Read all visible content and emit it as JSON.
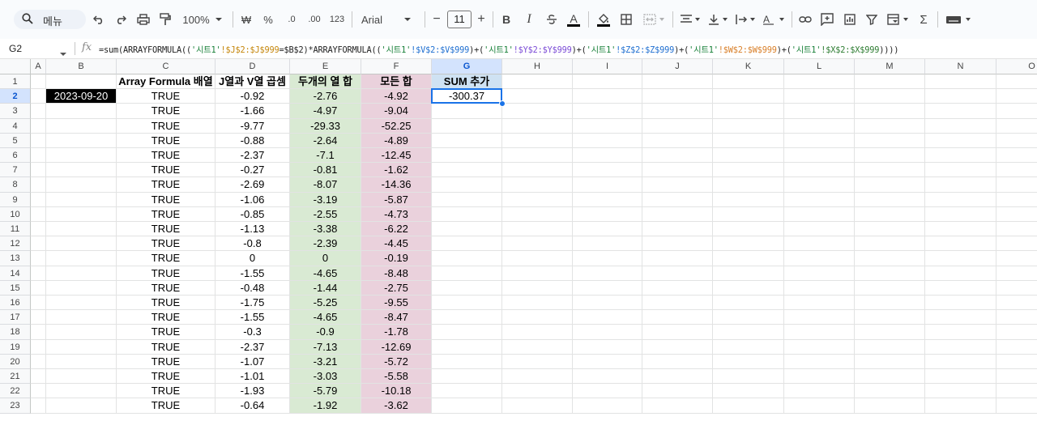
{
  "toolbar": {
    "menu_label": "메뉴",
    "zoom": "100%",
    "currency": "₩",
    "percent": "%",
    "dec_decrease": ".0",
    "dec_increase": ".00",
    "number_format": "123",
    "font_name": "Arial",
    "font_size": "11",
    "minus": "−",
    "plus": "+",
    "bold": "B",
    "italic": "I",
    "text_color_letter": "A",
    "sigma": "Σ"
  },
  "formula_bar": {
    "cell_ref": "G2",
    "fx": "fx",
    "formula_parts": {
      "p1": "=sum(ARRAYFORMULA((",
      "s1": "'시트1'",
      "r1": "!$J$2:$J$999",
      "p2": "=$B$2)*ARRAYFORMULA((",
      "s2": "'시트1'",
      "r2": "!$V$2:$V$999",
      "p3": ")+(",
      "s3": "'시트1'",
      "r3": "!$Y$2:$Y$999",
      "p4": ")+(",
      "s4": "'시트1'",
      "r4": "!$Z$2:$Z$999",
      "p5": ")+(",
      "s5": "'시트1'",
      "r5": "!$W$2:$W$999",
      "p6": ")+(",
      "s6": "'시트1'",
      "r6": "!$X$2:$X$999",
      "p7": "))))"
    }
  },
  "columns": [
    "A",
    "B",
    "C",
    "D",
    "E",
    "F",
    "G",
    "H",
    "I",
    "J",
    "K",
    "L",
    "M",
    "N",
    "O"
  ],
  "headers": {
    "C": "Array Formula 배열",
    "D": "J열과 V열 곱셈",
    "E": "두개의 열 합",
    "F": "모든 합",
    "G": "SUM 추가"
  },
  "date_cell": "2023-09-20",
  "sum_value": "-300.37",
  "rows": [
    {
      "n": "2",
      "c": "TRUE",
      "d": "-0.92",
      "e": "-2.76",
      "f": "-4.92"
    },
    {
      "n": "3",
      "c": "TRUE",
      "d": "-1.66",
      "e": "-4.97",
      "f": "-9.04"
    },
    {
      "n": "4",
      "c": "TRUE",
      "d": "-9.77",
      "e": "-29.33",
      "f": "-52.25"
    },
    {
      "n": "5",
      "c": "TRUE",
      "d": "-0.88",
      "e": "-2.64",
      "f": "-4.89"
    },
    {
      "n": "6",
      "c": "TRUE",
      "d": "-2.37",
      "e": "-7.1",
      "f": "-12.45"
    },
    {
      "n": "7",
      "c": "TRUE",
      "d": "-0.27",
      "e": "-0.81",
      "f": "-1.62"
    },
    {
      "n": "8",
      "c": "TRUE",
      "d": "-2.69",
      "e": "-8.07",
      "f": "-14.36"
    },
    {
      "n": "9",
      "c": "TRUE",
      "d": "-1.06",
      "e": "-3.19",
      "f": "-5.87"
    },
    {
      "n": "10",
      "c": "TRUE",
      "d": "-0.85",
      "e": "-2.55",
      "f": "-4.73"
    },
    {
      "n": "11",
      "c": "TRUE",
      "d": "-1.13",
      "e": "-3.38",
      "f": "-6.22"
    },
    {
      "n": "12",
      "c": "TRUE",
      "d": "-0.8",
      "e": "-2.39",
      "f": "-4.45"
    },
    {
      "n": "13",
      "c": "TRUE",
      "d": "0",
      "e": "0",
      "f": "-0.19"
    },
    {
      "n": "14",
      "c": "TRUE",
      "d": "-1.55",
      "e": "-4.65",
      "f": "-8.48"
    },
    {
      "n": "15",
      "c": "TRUE",
      "d": "-0.48",
      "e": "-1.44",
      "f": "-2.75"
    },
    {
      "n": "16",
      "c": "TRUE",
      "d": "-1.75",
      "e": "-5.25",
      "f": "-9.55"
    },
    {
      "n": "17",
      "c": "TRUE",
      "d": "-1.55",
      "e": "-4.65",
      "f": "-8.47"
    },
    {
      "n": "18",
      "c": "TRUE",
      "d": "-0.3",
      "e": "-0.9",
      "f": "-1.78"
    },
    {
      "n": "19",
      "c": "TRUE",
      "d": "-2.37",
      "e": "-7.13",
      "f": "-12.69"
    },
    {
      "n": "20",
      "c": "TRUE",
      "d": "-1.07",
      "e": "-3.21",
      "f": "-5.72"
    },
    {
      "n": "21",
      "c": "TRUE",
      "d": "-1.01",
      "e": "-3.03",
      "f": "-5.58"
    },
    {
      "n": "22",
      "c": "TRUE",
      "d": "-1.93",
      "e": "-5.79",
      "f": "-10.18"
    },
    {
      "n": "23",
      "c": "TRUE",
      "d": "-0.64",
      "e": "-1.92",
      "f": "-3.62"
    }
  ],
  "colors": {
    "green_fill": "#d9ead3",
    "pink_fill": "#ead1dc",
    "blue_fill": "#cfe2f3",
    "selection": "#1a73e8"
  }
}
